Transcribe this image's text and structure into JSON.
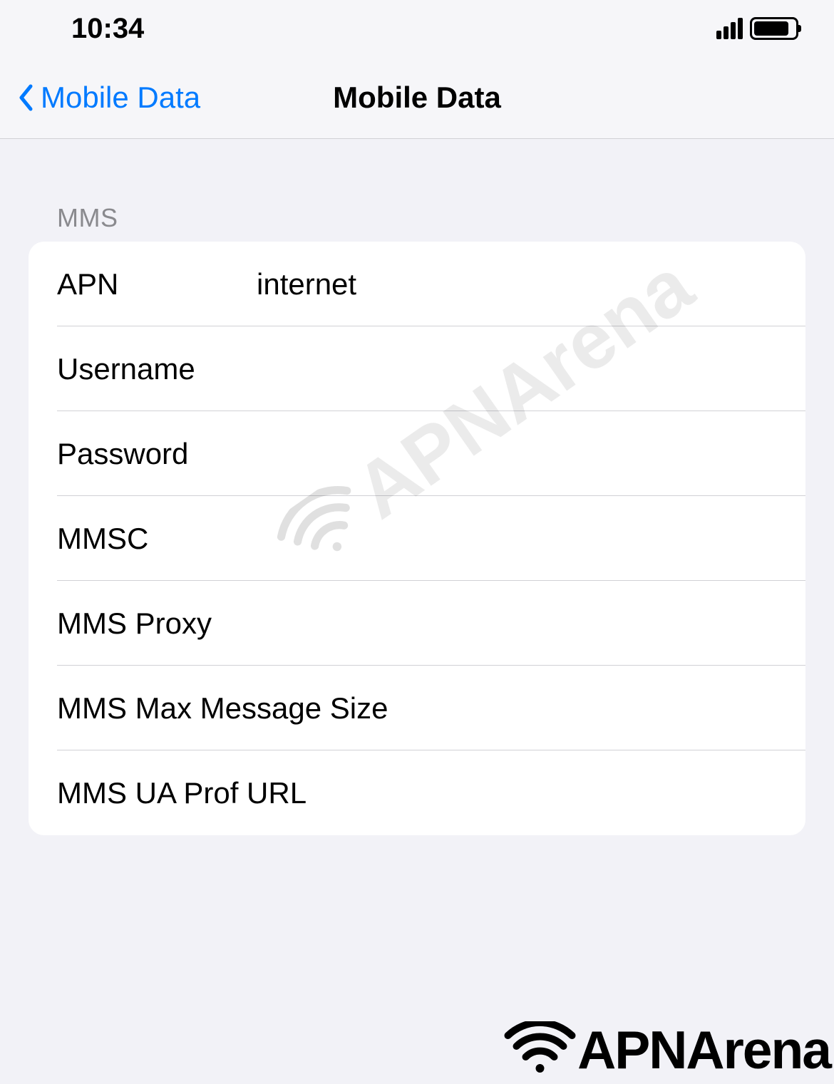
{
  "statusBar": {
    "time": "10:34"
  },
  "navBar": {
    "backLabel": "Mobile Data",
    "title": "Mobile Data"
  },
  "section": {
    "header": "MMS",
    "fields": {
      "apn": {
        "label": "APN",
        "value": "internet"
      },
      "username": {
        "label": "Username",
        "value": ""
      },
      "password": {
        "label": "Password",
        "value": ""
      },
      "mmsc": {
        "label": "MMSC",
        "value": ""
      },
      "mmsProxy": {
        "label": "MMS Proxy",
        "value": ""
      },
      "mmsMaxSize": {
        "label": "MMS Max Message Size",
        "value": ""
      },
      "mmsUaProf": {
        "label": "MMS UA Prof URL",
        "value": ""
      }
    }
  },
  "branding": {
    "watermark": "APNArena",
    "logo": "APNArena"
  }
}
